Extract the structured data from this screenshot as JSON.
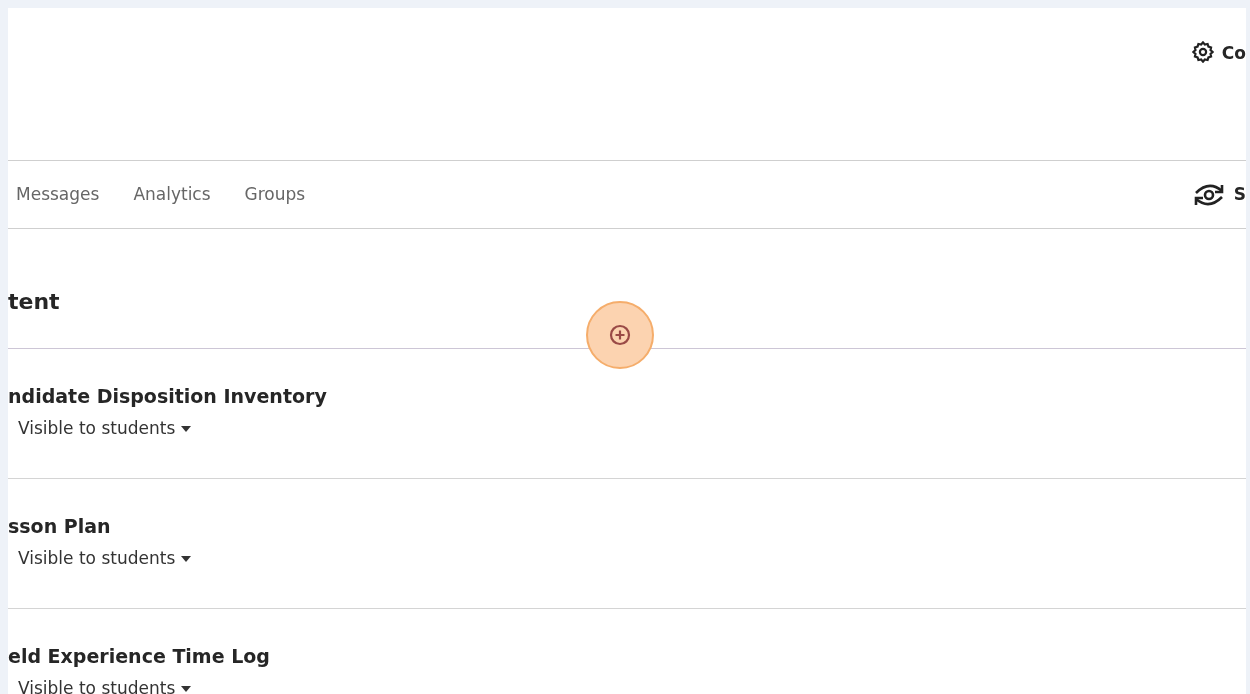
{
  "header": {
    "settings_label": "Co"
  },
  "tabs": [
    {
      "label": "Messages",
      "selected": false
    },
    {
      "label": "Analytics",
      "selected": false
    },
    {
      "label": "Groups",
      "selected": false
    }
  ],
  "student_view": {
    "label": "S"
  },
  "content": {
    "heading": "tent",
    "items": [
      {
        "title": "ndidate Disposition Inventory",
        "visibility": "Visible to students"
      },
      {
        "title": "sson Plan",
        "visibility": "Visible to students"
      },
      {
        "title": "eld Experience Time Log",
        "visibility": "Visible to students"
      }
    ]
  }
}
